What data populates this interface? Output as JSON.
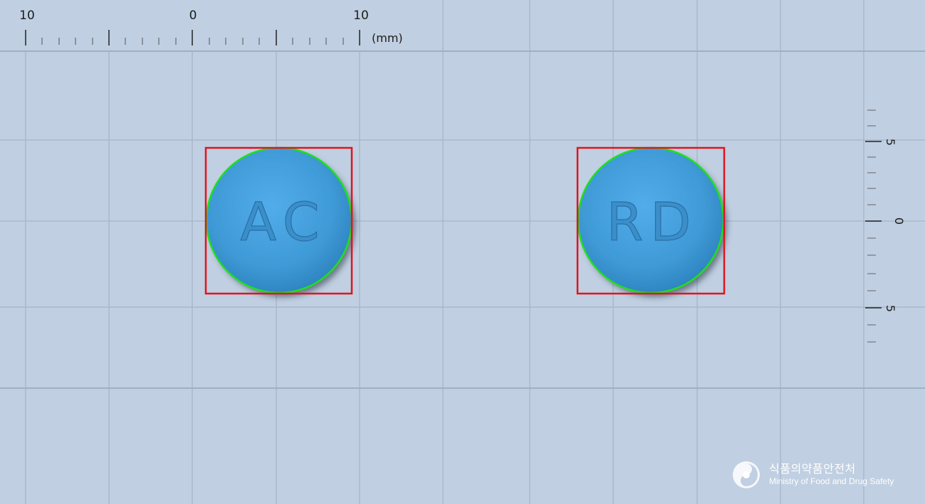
{
  "ruler_top": {
    "labels": [
      "10",
      "0",
      "10"
    ],
    "unit": "(mm)"
  },
  "ruler_right": {
    "labels": [
      "5",
      "0",
      "5"
    ]
  },
  "pills": [
    {
      "imprint": "AC",
      "color": "#3f9ad6"
    },
    {
      "imprint": "RD",
      "color": "#3f9ad6"
    }
  ],
  "brand": {
    "name_ko": "식품의약품안전처",
    "name_en": "Ministry of Food and Drug Safety"
  },
  "colors": {
    "background": "#c0cfe1",
    "grid": "#a9b8cc",
    "detection_box": "#e0141e",
    "contour": "#1ee01e",
    "pill": "#3f9ad6"
  }
}
